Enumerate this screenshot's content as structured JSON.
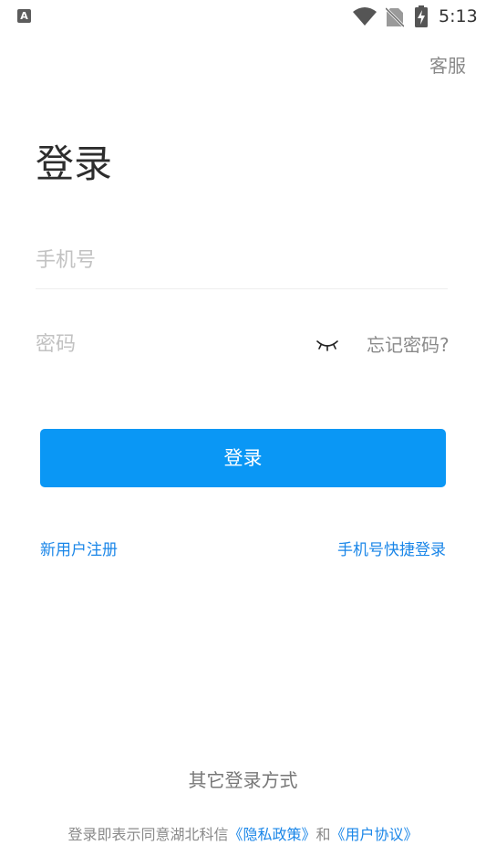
{
  "status_bar": {
    "notification_letter": "A",
    "time": "5:13",
    "icons": [
      "notification-a-icon",
      "wifi-icon",
      "no-sim-icon",
      "battery-charging-icon"
    ]
  },
  "header": {
    "service_label": "客服",
    "title": "登录"
  },
  "form": {
    "phone_placeholder": "手机号",
    "phone_value": "",
    "password_placeholder": "密码",
    "password_value": "",
    "password_toggle_icon": "eye-closed-icon",
    "forgot_label": "忘记密码?",
    "login_label": "登录"
  },
  "links": {
    "register_label": "新用户注册",
    "quick_login_label": "手机号快捷登录"
  },
  "footer": {
    "other_methods_label": "其它登录方式",
    "agreement_prefix": "登录即表示同意湖北科信",
    "privacy_policy": "《隐私政策》",
    "conjunction": "和",
    "user_agreement": "《用户协议》"
  },
  "colors": {
    "accent": "#0a97f5",
    "link": "#1a86e8",
    "placeholder": "#c2c2c2",
    "secondary_text": "#8a8a8a"
  }
}
